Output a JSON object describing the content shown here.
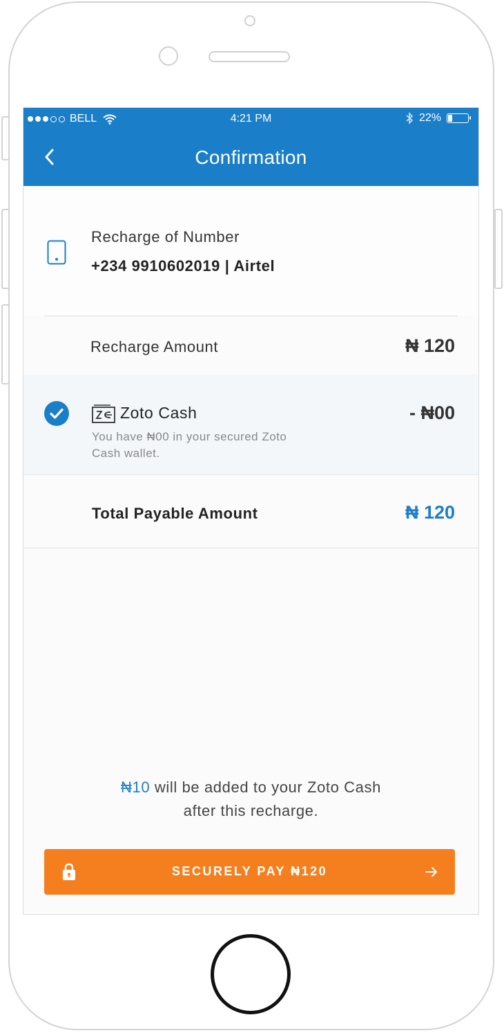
{
  "status_bar": {
    "carrier": "BELL",
    "time": "4:21 PM",
    "battery": "22%",
    "battery_level": 0.22
  },
  "nav": {
    "title": "Confirmation"
  },
  "recharge": {
    "label": "Recharge of Number",
    "number": "+234 9910602019 | Airtel"
  },
  "amount": {
    "label": "Recharge Amount",
    "value": "₦ 120"
  },
  "zoto_cash": {
    "title": "Zoto Cash",
    "description": "You have ₦00 in your secured Zoto Cash wallet.",
    "value": "- ₦00",
    "checked": true
  },
  "total": {
    "label": "Total Payable Amount",
    "value": "₦ 120"
  },
  "bonus": {
    "amount": "₦10",
    "text_1": " will be added to your Zoto Cash",
    "text_2": "after this recharge."
  },
  "pay_button": {
    "label": "SECURELY PAY ₦120"
  },
  "colors": {
    "primary": "#1b7ec9",
    "accent": "#f57f1e",
    "selected_row_bg": "#f3f7fa"
  },
  "icons": {
    "back": "chevron-left-icon",
    "device": "smartphone-icon",
    "check": "check-circle-icon",
    "wallet": "zoto-cash-icon",
    "lock": "lock-icon",
    "arrow": "arrow-right-icon",
    "wifi": "wifi-icon",
    "bluetooth": "bluetooth-icon"
  }
}
